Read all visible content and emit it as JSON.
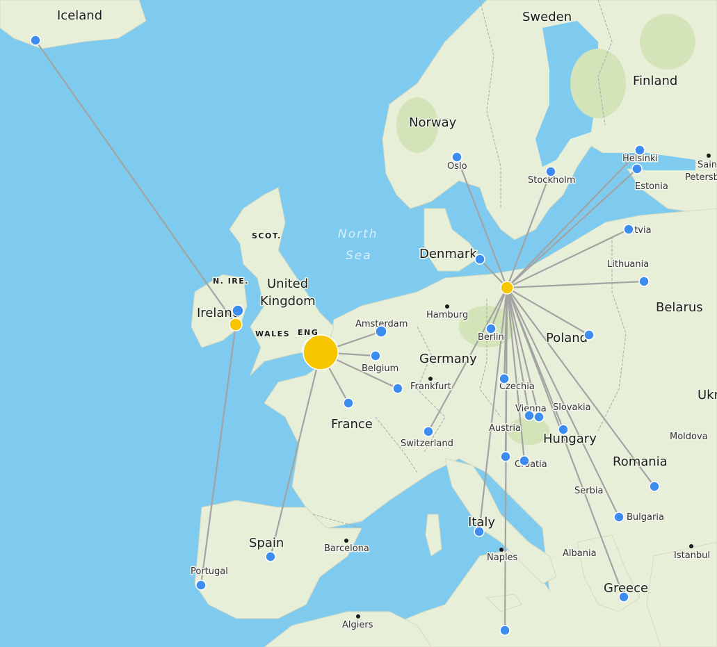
{
  "map": {
    "sea_label_line1": "North",
    "sea_label_line2": "Sea",
    "countries": {
      "iceland": "Iceland",
      "sweden": "Sweden",
      "finland": "Finland",
      "norway": "Norway",
      "denmark": "Denmark",
      "united_kingdom_line1": "United",
      "united_kingdom_line2": "Kingdom",
      "ireland": "Ireland",
      "germany": "Germany",
      "poland": "Poland",
      "belarus": "Belarus",
      "france": "France",
      "hungary": "Hungary",
      "romania": "Romania",
      "italy": "Italy",
      "spain": "Spain",
      "greece": "Greece",
      "ukraine_partial": "Ukr"
    },
    "regions": {
      "scotland": "SCOT.",
      "n_ireland": "N. IRE.",
      "wales": "WALES",
      "england": "ENG"
    },
    "cities": {
      "oslo": "Oslo",
      "stockholm": "Stockholm",
      "helsinki": "Helsinki",
      "saint_petersburg_line1": "Sain",
      "saint_petersburg_line2": "Petersb",
      "estonia": "Estonia",
      "latvia": "Latvia",
      "lithuania": "Lithuania",
      "amsterdam": "Amsterdam",
      "hamburg": "Hamburg",
      "berlin": "Berlin",
      "belgium": "Belgium",
      "frankfurt": "Frankfurt",
      "czechia": "Czechia",
      "slovakia": "Slovakia",
      "vienna": "Vienna",
      "austria": "Austria",
      "switzerland": "Switzerland",
      "moldova": "Moldova",
      "croatia": "Croatia",
      "serbia": "Serbia",
      "bulgaria": "Bulgaria",
      "albania": "Albania",
      "istanbul": "Istanbul",
      "naples": "Naples",
      "barcelona": "Barcelona",
      "portugal": "Portugal",
      "algiers": "Algiers"
    }
  },
  "colors": {
    "sea": "#7ecbef",
    "land": "#e8efd8",
    "hub": "#f7c600",
    "destination": "#3d8cf0",
    "route": "#a3a3a3"
  }
}
